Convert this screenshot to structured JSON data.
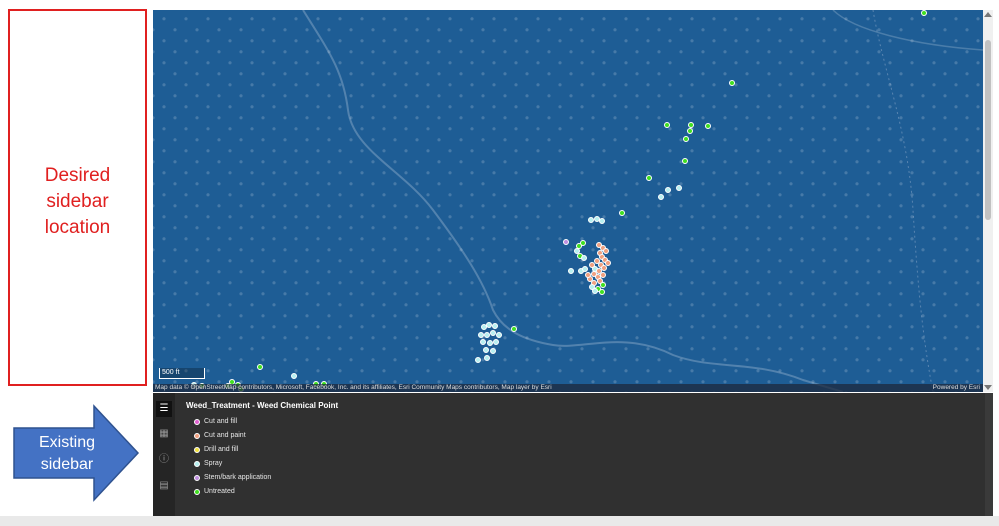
{
  "annotations": {
    "desired": "Desired\nsidebar\nlocation",
    "existing": "Existing\nsidebar",
    "desired_color": "#e02020",
    "existing_color": "#4472c4"
  },
  "map": {
    "scale_label": "500 ft",
    "attribution": "Map data © OpenStreetMap contributors, Microsoft, Facebook, Inc. and its affiliates, Esri Community Maps contributors, Map layer by Esri",
    "powered_by": "Powered by Esri",
    "background_color": "#1e5d95"
  },
  "toolbar": {
    "tools": [
      {
        "name": "legend-tool",
        "icon": "list-icon",
        "active": true
      },
      {
        "name": "layer-list-tool",
        "icon": "grid-icon",
        "active": false
      },
      {
        "name": "info-tool",
        "icon": "info-icon",
        "active": false
      },
      {
        "name": "print-tool",
        "icon": "document-icon",
        "active": false
      }
    ]
  },
  "legend": {
    "layer_title": "Weed_Treatment - Weed Chemical Point",
    "items": [
      {
        "label": "Cut and fill",
        "color": "#e060d0"
      },
      {
        "label": "Cut and paint",
        "color": "#f0a080"
      },
      {
        "label": "Drill and fill",
        "color": "#f0e040"
      },
      {
        "label": "Spray",
        "color": "#b8f0f0"
      },
      {
        "label": "Stem/bark application",
        "color": "#c090e0"
      },
      {
        "label": "Untreated",
        "color": "#40e020"
      }
    ]
  }
}
